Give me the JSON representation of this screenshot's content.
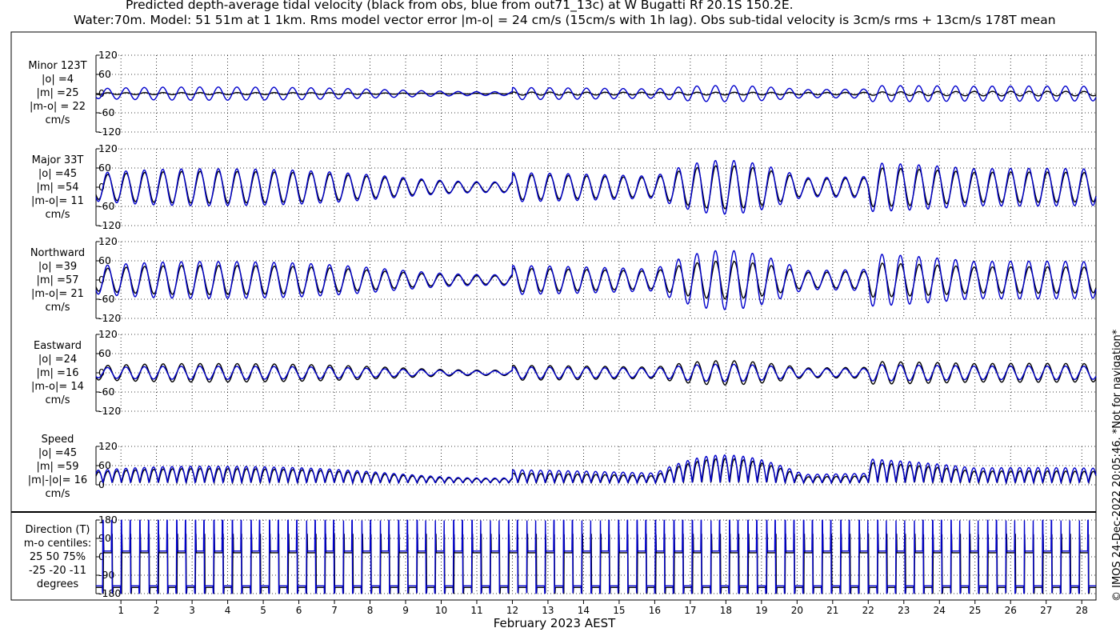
{
  "title_line1": "Predicted depth-average tidal velocity (black from obs, blue from out71_13c) at W Bugatti Rf 20.1S 150.2E.",
  "title_line2": "Water:70m. Model: 51 51m at 1 1km. Rms model vector error |m-o| = 24 cm/s (15cm/s with 1h lag). Obs sub-tidal velocity is 3cm/s rms + 13cm/s 178T mean",
  "credit": "© IMOS 24-Dec-2022 20:05:46. *Not for navigation*",
  "chart_data": {
    "type": "line",
    "xlabel": "February 2023 AEST",
    "x_ticks": [
      "1",
      "2",
      "3",
      "4",
      "5",
      "6",
      "7",
      "8",
      "9",
      "10",
      "11",
      "12",
      "13",
      "14",
      "15",
      "16",
      "17",
      "18",
      "19",
      "20",
      "21",
      "22",
      "23",
      "24",
      "25",
      "26",
      "27",
      "28"
    ],
    "xlim": [
      0.3,
      28.4
    ],
    "grid": true,
    "series_colors": {
      "obs": "#000000",
      "model": "#0000cc"
    },
    "panels": [
      {
        "id": "minor",
        "label": [
          "Minor 123T",
          "|o| =4",
          "|m| =25",
          "|m-o| = 22",
          "cm/s"
        ],
        "yticks": [
          "120",
          "60",
          "0",
          "-60",
          "-120"
        ],
        "ylim": [
          -120,
          120
        ],
        "obs_amp": [
          4,
          4,
          5,
          6
        ],
        "model_amp": [
          25,
          15,
          30,
          20
        ]
      },
      {
        "id": "major",
        "label": [
          "Major 33T",
          "|o| =45",
          "|m| =54",
          "|m-o|= 11",
          "cm/s"
        ],
        "yticks": [
          "120",
          "60",
          "0",
          "-60",
          "-120"
        ],
        "ylim": [
          -120,
          120
        ],
        "obs_amp": [
          60,
          30,
          80,
          40
        ],
        "model_amp": [
          70,
          35,
          100,
          50
        ]
      },
      {
        "id": "north",
        "label": [
          "Northward",
          "|o| =39",
          "|m| =57",
          "|m-o|= 21",
          "cm/s"
        ],
        "yticks": [
          "120",
          "60",
          "0",
          "-60",
          "-120"
        ],
        "ylim": [
          -120,
          120
        ],
        "obs_amp": [
          55,
          28,
          70,
          35
        ],
        "model_amp": [
          70,
          35,
          110,
          50
        ]
      },
      {
        "id": "east",
        "label": [
          "Eastward",
          "|o| =24",
          "|m| =16",
          "|m-o|= 14",
          "cm/s"
        ],
        "yticks": [
          "120",
          "60",
          "0",
          "-60",
          "-120"
        ],
        "ylim": [
          -120,
          120
        ],
        "obs_amp": [
          35,
          18,
          45,
          25
        ],
        "model_amp": [
          25,
          14,
          32,
          18
        ]
      },
      {
        "id": "speed",
        "label": [
          "Speed",
          "|o| =45",
          "|m| =59",
          "|m|-|o|= 16",
          "cm/s"
        ],
        "yticks": [
          "120",
          "60",
          "0"
        ],
        "ylim": [
          0,
          120
        ],
        "obs_amp": [
          60,
          25,
          100,
          35
        ],
        "model_amp": [
          70,
          35,
          115,
          45
        ]
      },
      {
        "id": "dir",
        "label": [
          "Direction (T)",
          "m-o centiles:",
          "25  50  75%",
          "-25 -20 -11",
          "degrees"
        ],
        "yticks": [
          "180",
          "90",
          "0",
          "-90",
          "-180"
        ],
        "ylim": [
          -180,
          180
        ]
      }
    ]
  }
}
